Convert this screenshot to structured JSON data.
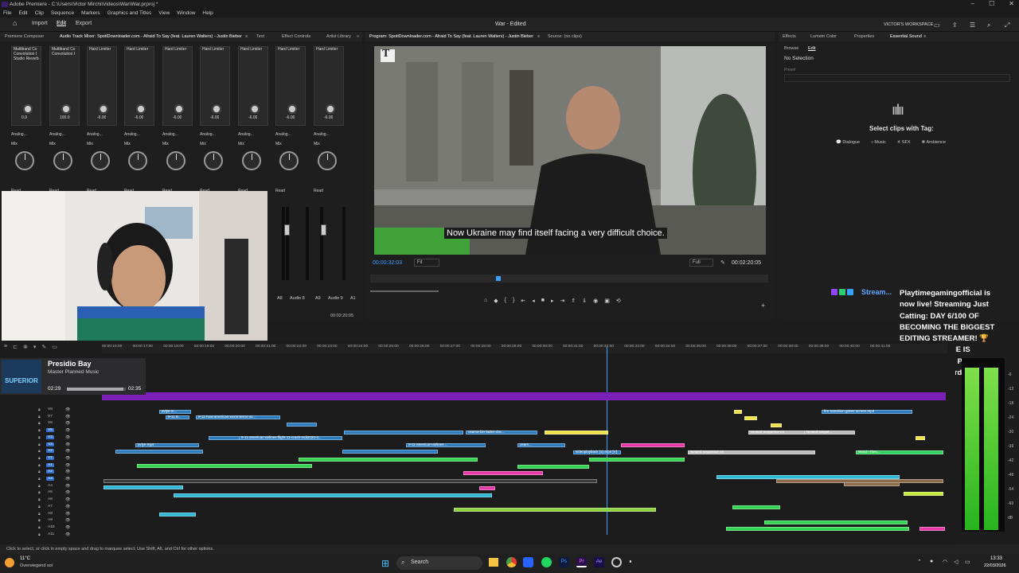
{
  "titlebar": {
    "title": "Adobe Premiere - C:\\Users\\Victor Mirchi\\Videos\\War\\War.prproj *",
    "minimize": "–",
    "maximize": "☐",
    "close": "✕"
  },
  "menu": [
    "File",
    "Edit",
    "Clip",
    "Sequence",
    "Markers",
    "Graphics and Titles",
    "View",
    "Window",
    "Help"
  ],
  "workbar": {
    "home": "⌂",
    "nav": [
      "Import",
      "Edit",
      "Export"
    ],
    "active": "Edit",
    "doc_title": "War - Edited",
    "workspace": "VICTOR'S WORKSPACE"
  },
  "mixer_tabs": [
    "Premiere Composer",
    "Audio Track Mixer: SpotiDownloader.com - Afraid To Say (feat. Lauren Walters) - Justin Bieber",
    "≡",
    "Text",
    "Effect Controls",
    "Artist Library",
    "»"
  ],
  "channels": [
    {
      "fx": [
        "Multiband Co",
        "Convolution I",
        "Studio Reverb"
      ],
      "val": "0.0",
      "sel1": "Analog...",
      "sel2": "Mix",
      "read": "Read"
    },
    {
      "fx": [
        "Multiband Co",
        "Convolution I"
      ],
      "val": "100.0",
      "sel1": "Analog...",
      "sel2": "Mix",
      "read": "Read"
    },
    {
      "fx": [
        "Hard Limiter"
      ],
      "val": "-6.00",
      "sel1": "Analog...",
      "sel2": "Mix",
      "read": "Read"
    },
    {
      "fx": [
        "Hard Limiter"
      ],
      "val": "-6.00",
      "sel1": "Analog...",
      "sel2": "Mix",
      "read": "Read"
    },
    {
      "fx": [
        "Hard Limiter"
      ],
      "val": "-6.00",
      "sel1": "Analog...",
      "sel2": "Mix",
      "read": "Read"
    },
    {
      "fx": [
        "Hard Limiter"
      ],
      "val": "-6.00",
      "sel1": "Analog...",
      "sel2": "Mix",
      "read": "Read"
    },
    {
      "fx": [
        "Hard Limiter"
      ],
      "val": "-6.00",
      "sel1": "Analog...",
      "sel2": "Mix",
      "read": "Read"
    },
    {
      "fx": [
        "Hard Limiter"
      ],
      "val": "-6.00",
      "sel1": "Analog...",
      "sel2": "Mix",
      "read": "Read"
    },
    {
      "fx": [
        "Hard Limiter"
      ],
      "val": "-6.00",
      "sel1": "Analog...",
      "sel2": "Mix",
      "read": "Read"
    }
  ],
  "meter_labels": [
    "A8",
    "Audio 8",
    "A9",
    "Audio 9",
    "A1"
  ],
  "mixer_time": "00:02:20:05",
  "program": {
    "tabs": [
      "Program: SpotiDownloader.com - Afraid To Say (feat. Lauren Walters) - Justin Bieber",
      "≡",
      "Source: (no clips)"
    ],
    "subtitle": "Now Ukraine may find itself facing a very difficult choice.",
    "watermark": "T",
    "timecode": "00:00:32:03",
    "fit": "Fit",
    "quality": "Full",
    "duration": "00:02:20:05"
  },
  "esound": {
    "tabs": [
      "Effects",
      "Lumetri Color",
      "Properties",
      "Essential Sound",
      "≡"
    ],
    "subtabs": [
      "Browse",
      "Edit"
    ],
    "no_selection": "No Selection",
    "preset": "Preset",
    "select_label": "Select clips with Tag:",
    "tags": [
      "Dialogue",
      "Music",
      "SFX",
      "Ambience"
    ]
  },
  "chat": {
    "user": "Stream...",
    "message": "Playtimegamingofficial is now live! Streaming Just Catting: DAY 6/100 OF BECOMING THE BIGGEST EDITING STREAMER! 🏆 WHY EVERYONE IS SWITCHING TO PREMIERE PRO! ✏️ !discord !instagram !sr !youtube"
  },
  "now_playing": {
    "title": "Presidio Bay",
    "artist": "Master Planned Music",
    "elapsed": "02:29",
    "total": "02:35",
    "art_text": "SUPERIOR"
  },
  "timeline": {
    "ticks": [
      "00:00:16:00",
      "00:00:17:00",
      "00:00:18:00",
      "00:00:19:00",
      "00:00:20:00",
      "00:00:21:00",
      "00:00:22:00",
      "00:00:23:00",
      "00:00:24:00",
      "00:00:25:00",
      "00:00:26:00",
      "00:00:27:00",
      "00:00:28:00",
      "00:00:29:00",
      "00:00:30:00",
      "00:00:31:00",
      "00:00:32:00",
      "00:00:33:00",
      "00:00:34:00",
      "00:00:35:00",
      "00:00:36:00",
      "00:00:37:00",
      "00:00:38:00",
      "00:00:39:00",
      "00:00:40:00",
      "00:00:41:00"
    ],
    "tracks": [
      "V8",
      "V7",
      "V6",
      "V5",
      "V4",
      "V3",
      "V2",
      "V1",
      "A1",
      "A2",
      "A3",
      "A4",
      "A5",
      "A6",
      "A7",
      "A8",
      "A9",
      "A10",
      "A11"
    ],
    "clip_labels": [
      "avlye.m...",
      "9-11 B...",
      "9-11-how-americas-worst-terror-at...",
      "9-11-american-airlines-flight-11-crash-mdi2020-4...",
      "osama-bin-laden-doc...",
      "9-11-american-airlines-...",
      "avlye.mp4",
      "9-11-american-airlines-...",
      "Nested Sequence 04",
      "osam...",
      "Nested Sequence 04",
      "fire transition green screen.mp4",
      "Nested Seque...",
      "videoplayback (1).mp4 [V]",
      "Watch Thes..."
    ],
    "meter_db": [
      "-6",
      "-12",
      "-18",
      "-24",
      "-30",
      "-36",
      "-42",
      "-48",
      "-54",
      "-60",
      "dB"
    ]
  },
  "status": "Click to select, or click in empty space and drag to marquee select. Use Shift, Alt, and Ctrl for other options.",
  "taskbar": {
    "weather_temp": "11°C",
    "weather_desc": "Overwiegend sol",
    "search": "Search",
    "time": "13:33",
    "date": "22/03/2026"
  }
}
